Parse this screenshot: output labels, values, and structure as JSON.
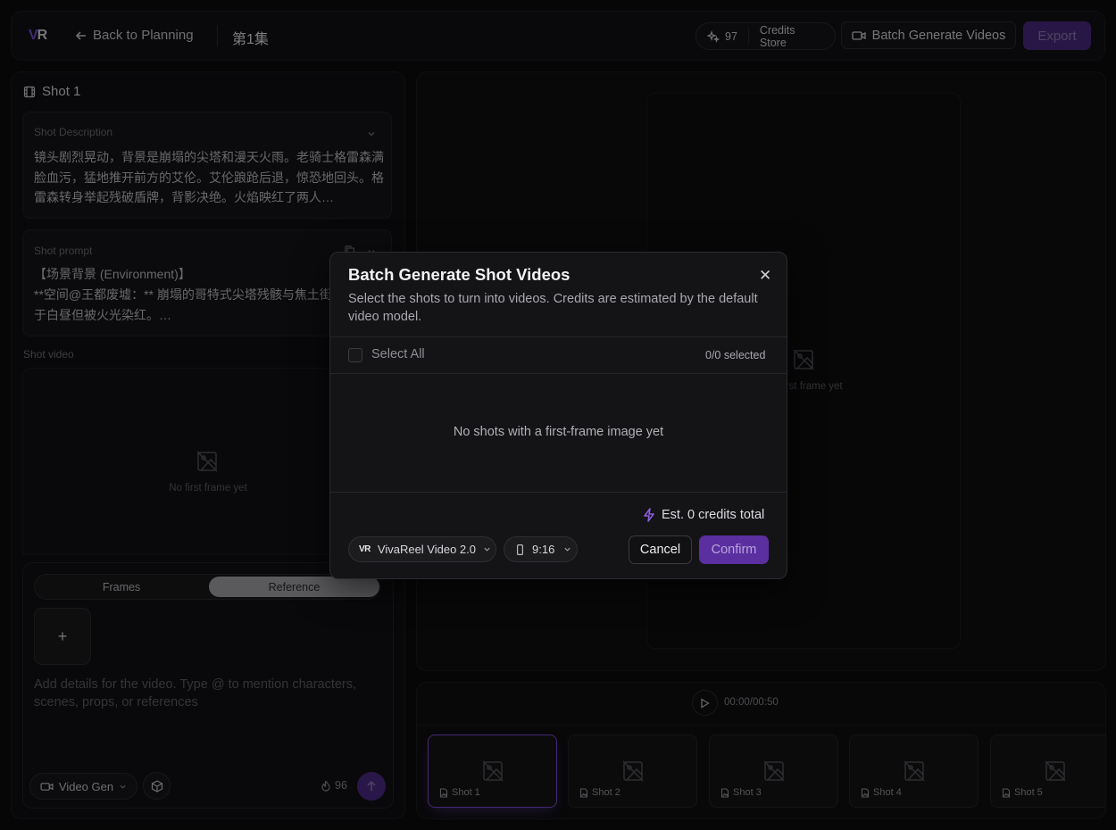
{
  "header": {
    "logo": "VR",
    "back_label": "Back to Planning",
    "episode_title": "第1集",
    "credits": "97",
    "credits_store": "Credits Store",
    "batch_generate": "Batch Generate Videos",
    "export": "Export"
  },
  "left": {
    "shot_title": "Shot 1",
    "description_label": "Shot Description",
    "description_text": "镜头剧烈晃动，背景是崩塌的尖塔和漫天火雨。老骑士格雷森满脸血污，猛地推开前方的艾伦。艾伦踉跄后退，惊恐地回头。格雷森转身举起残破盾牌，背影决绝。火焰映红了两人…",
    "prompt_label": "Shot prompt",
    "prompt_lines": [
      "【场景背景 (Environment)】",
      "**空间@王都废墟：** 崩塌的哥特式尖塔残骸与焦土街",
      "于白昼但被火光染红。…"
    ],
    "video_label": "Shot video",
    "no_frame": "No first frame yet",
    "tabs": {
      "frames": "Frames",
      "reference": "Reference"
    },
    "add_symbol": "+",
    "composer_placeholder": "Add details for the video. Type @ to mention characters, scenes, props, or references",
    "mode": "Video Gen",
    "cost": "96"
  },
  "preview": {
    "hint": "first frame yet"
  },
  "timeline": {
    "time": "00:00/00:50",
    "shots": [
      "Shot 1",
      "Shot 2",
      "Shot 3",
      "Shot 4",
      "Shot 5"
    ]
  },
  "modal": {
    "title": "Batch Generate Shot Videos",
    "description": "Select the shots to turn into videos. Credits are estimated by the default video model.",
    "select_all": "Select All",
    "selected_count": "0/0 selected",
    "empty": "No shots with a first-frame image yet",
    "estimate": "Est. 0 credits total",
    "model": "VivaReel Video 2.0",
    "model_logo": "VR",
    "ratio": "9:16",
    "cancel": "Cancel",
    "confirm": "Confirm"
  },
  "colors": {
    "accent": "#7a4bd0",
    "accent_dark": "#4d2a86",
    "background": "#0b0b0d"
  }
}
